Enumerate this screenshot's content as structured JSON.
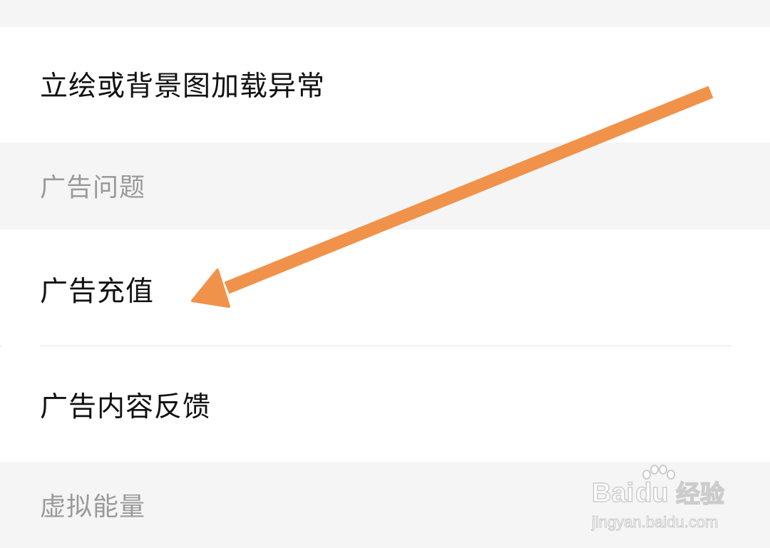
{
  "items": {
    "image_loading_issue": "立绘或背景图加载异常",
    "ad_recharge": "广告充值",
    "ad_content_feedback": "广告内容反馈"
  },
  "sections": {
    "ad_issues": "广告问题",
    "virtual_energy": "虚拟能量"
  },
  "annotation": {
    "arrow_color": "#F0924A",
    "arrow_target": "ad_recharge"
  },
  "watermark": {
    "brand_prefix": "Bai",
    "brand_suffix": "du",
    "brand_cn": "经验",
    "url": "jingyan.baidu.com"
  },
  "colors": {
    "section_background": "#F5F5F5",
    "row_background": "#FFFFFF",
    "primary_text": "#111111",
    "section_text": "#9A9A9A",
    "divider": "#E6E6E6"
  }
}
